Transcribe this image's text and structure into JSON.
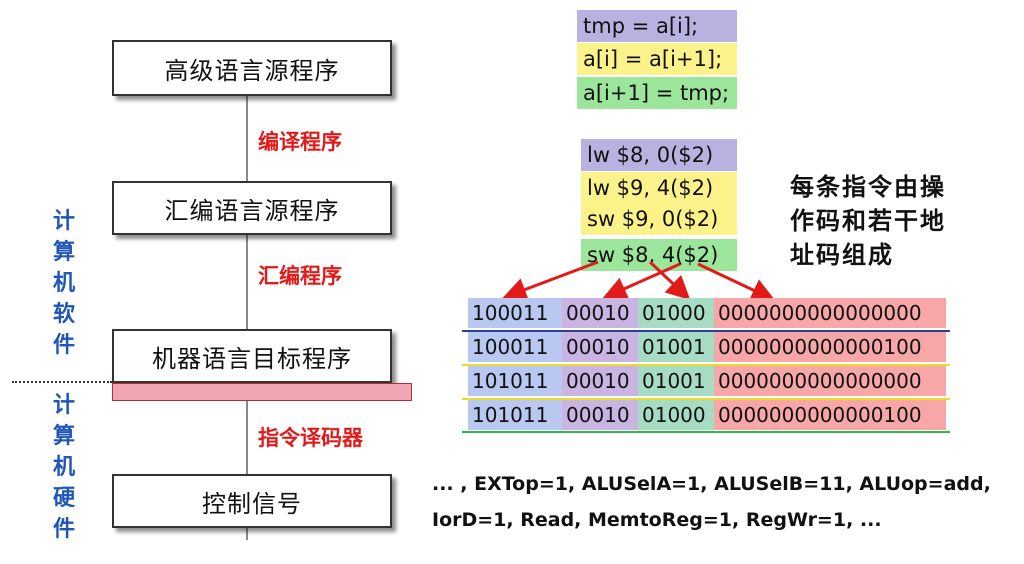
{
  "flow": {
    "box_high_level": "高级语言源程序",
    "label_compile": "编译程序",
    "box_assembly": "汇编语言源程序",
    "label_assemble": "汇编程序",
    "box_machine": "机器语言目标程序",
    "label_decoder": "指令译码器",
    "box_control": "控制信号"
  },
  "side": {
    "software_chars": [
      "计",
      "算",
      "机",
      "软",
      "件"
    ],
    "hardware_chars": [
      "计",
      "算",
      "机",
      "硬",
      "件"
    ]
  },
  "source_code": [
    "tmp = a[i];",
    "a[i] = a[i+1];",
    "a[i+1] = tmp;"
  ],
  "assembly": [
    "lw $8, 0($2)",
    "lw $9, 4($2)",
    "sw $9, 0($2)",
    "sw $8, 4($2)"
  ],
  "description": [
    "每条指令由操",
    "作码和若干地",
    "址码组成"
  ],
  "machine_code": [
    [
      "100011",
      "00010",
      "01000",
      "0000000000000000"
    ],
    [
      "100011",
      "00010",
      "01001",
      "0000000000000100"
    ],
    [
      "101011",
      "00010",
      "01001",
      "0000000000000000"
    ],
    [
      "101011",
      "00010",
      "01000",
      "0000000000000100"
    ]
  ],
  "control_signals": [
    "... ,  EXTop=1, ALUSelA=1, ALUSelB=11, ALUop=add,",
    "IorD=1, Read, MemtoReg=1, RegWr=1, ..."
  ],
  "colors": {
    "purple": "#b9b2e0",
    "yellow": "#fbf38a",
    "green": "#9be69b",
    "pink": "#f59b9b",
    "bin_purple": "#c9b4e2",
    "bin_teal": "#a6dcc4",
    "bin_pink": "#f7a7a7",
    "bin_blue": "#b8c8f0",
    "arrow_red": "#e21a1a"
  }
}
